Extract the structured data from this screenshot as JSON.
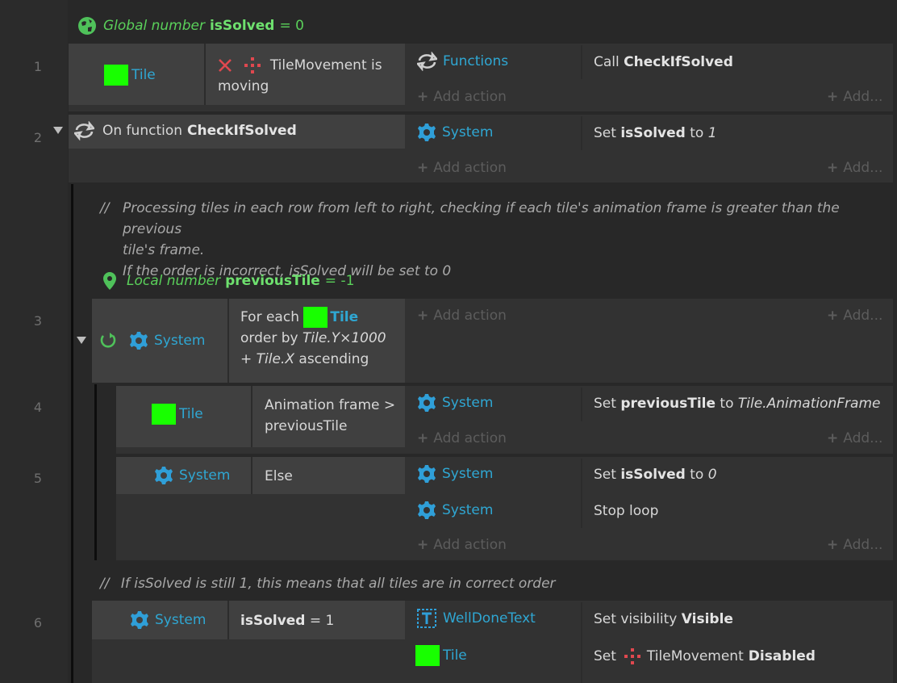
{
  "global_var": {
    "prefix": "Global number",
    "name": "isSolved",
    "suffix": "= 0"
  },
  "local_var": {
    "prefix": "Local number",
    "name": "previousTile",
    "suffix": "= -1"
  },
  "row_numbers": [
    "1",
    "2",
    "3",
    "4",
    "5",
    "6"
  ],
  "event1": {
    "cond_obj": "Tile",
    "cond_text_pre": "TileMovement is",
    "cond_text_post": "moving",
    "action_obj": "Functions",
    "action_text_pre": "Call",
    "action_text_bold": "CheckIfSolved"
  },
  "event2": {
    "trigger_pre": "On function",
    "trigger_bold": "CheckIfSolved",
    "action_obj": "System",
    "action_pre": "Set",
    "action_bold": "isSolved",
    "action_mid": "to",
    "action_val": "1"
  },
  "comment1": {
    "line1": "Processing tiles in each row from left to right, checking if each tile's animation frame is greater than the previous",
    "line2": "tile's frame.",
    "line3": "If the order is incorrect, isSolved will be set to 0"
  },
  "event3": {
    "cond_obj": "System",
    "l1_pre": "For each",
    "l1_obj": "Tile",
    "l2_pre": "order by",
    "l2_ital": "Tile.Y×1000",
    "l3_pre": "+",
    "l3_ital": "Tile.X",
    "l3_post": "ascending"
  },
  "event4": {
    "cond_obj": "Tile",
    "cond_l1": "Animation frame >",
    "cond_l2": "previousTile",
    "action_obj": "System",
    "action_pre": "Set",
    "action_bold": "previousTile",
    "action_mid": "to",
    "action_ital": "Tile.AnimationFrame"
  },
  "event5": {
    "cond_obj": "System",
    "cond_text": "Else",
    "a1_obj": "System",
    "a1_pre": "Set",
    "a1_bold": "isSolved",
    "a1_mid": "to",
    "a1_val": "0",
    "a2_obj": "System",
    "a2_text": "Stop loop"
  },
  "comment2": {
    "line1": "If isSolved is still 1, this means that all tiles are in correct order"
  },
  "event6": {
    "cond_obj": "System",
    "cond_bold": "isSolved",
    "cond_post": "= 1",
    "a1_obj": "WellDoneText",
    "a1_pre": "Set visibility",
    "a1_bold": "Visible",
    "a2_obj": "Tile",
    "a2_pre": "Set",
    "a2_mid": "TileMovement",
    "a2_bold": "Disabled"
  },
  "labels": {
    "add_action": "Add action",
    "add_more": "Add...",
    "comment_mark": "//"
  },
  "colors": {
    "tile_swatch": "#18ff00",
    "object_name": "#2fa7d3",
    "variable": "#5ad05a",
    "icon_red": "#e0484f"
  },
  "icons": [
    "globe-icon",
    "loop-icon",
    "gear-icon",
    "x-icon",
    "movement-icon",
    "pin-icon",
    "text-object-icon",
    "triangle-collapse-icon"
  ]
}
